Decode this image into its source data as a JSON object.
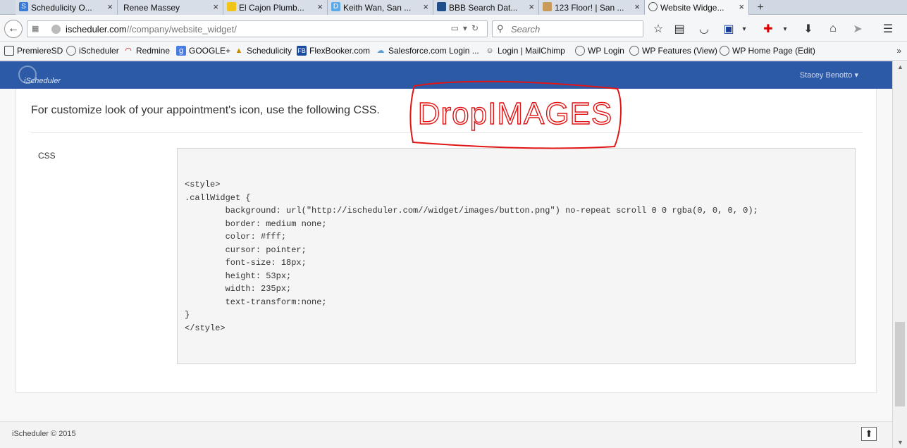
{
  "browser": {
    "tabs": [
      {
        "label": "Schedulicity O...",
        "close": "×"
      },
      {
        "label": "Renee Massey",
        "close": "×"
      },
      {
        "label": "El Cajon Plumb...",
        "close": "×"
      },
      {
        "label": "Keith Wan, San ...",
        "close": "×"
      },
      {
        "label": "BBB Search Dat...",
        "close": "×"
      },
      {
        "label": "123 Floor! | San ...",
        "close": "×"
      },
      {
        "label": "Website Widge...",
        "close": "×"
      }
    ],
    "new_tab": "+",
    "url_host": "ischeduler.com",
    "url_path": "//company/website_widget/",
    "search_placeholder": "Search",
    "bookmarks": [
      "PremiereSD",
      "iScheduler",
      "Redmine",
      "GOOGLE+",
      "Schedulicity",
      "FlexBooker.com",
      "Salesforce.com Login ...",
      "Login | MailChimp",
      "WP Login",
      "WP Features (View)",
      "WP Home Page (Edit)"
    ],
    "bookmarks_more": "»"
  },
  "app": {
    "logo_text": "iScheduler",
    "user_name": "Stacey Benotto",
    "user_caret": "▾",
    "intro": "For customize look of your appointment's icon, use the following CSS.",
    "css_label": "CSS",
    "css_code": "<style>\n.callWidget {\n        background: url(\"http://ischeduler.com//widget/images/button.png\") no-repeat scroll 0 0 rgba(0, 0, 0, 0);\n        border: medium none;\n        color: #fff;\n        cursor: pointer;\n        font-size: 18px;\n        height: 53px;\n        width: 235px;\n        text-transform:none;\n}\n</style>",
    "annotation_text": "DropIMAGES",
    "footer_copy": "iScheduler © 2015",
    "back_to_top": "⬆"
  },
  "colors": {
    "header_blue": "#2d5aa6",
    "annotation_red": "#e01515"
  }
}
